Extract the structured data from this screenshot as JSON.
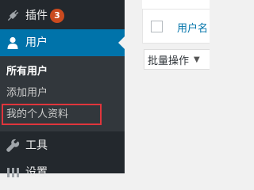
{
  "sidebar": {
    "plugins": {
      "label": "插件",
      "badge": "3",
      "icon": "plug-icon"
    },
    "users": {
      "label": "用户",
      "icon": "user-icon"
    },
    "users_submenu": {
      "all_users": "所有用户",
      "add_user": "添加用户",
      "my_profile": "我的个人资料"
    },
    "tools": {
      "label": "工具",
      "icon": "wrench-icon"
    },
    "settings": {
      "label": "设置",
      "icon": "settings-icon"
    }
  },
  "content": {
    "column_username": "用户名",
    "bulk_actions": "批量操作"
  },
  "colors": {
    "sidebar_bg": "#23282d",
    "submenu_bg": "#32373c",
    "active_bg": "#0073aa",
    "badge_bg": "#ca4a1f",
    "highlight_border": "#e0353c",
    "link": "#0073aa"
  }
}
